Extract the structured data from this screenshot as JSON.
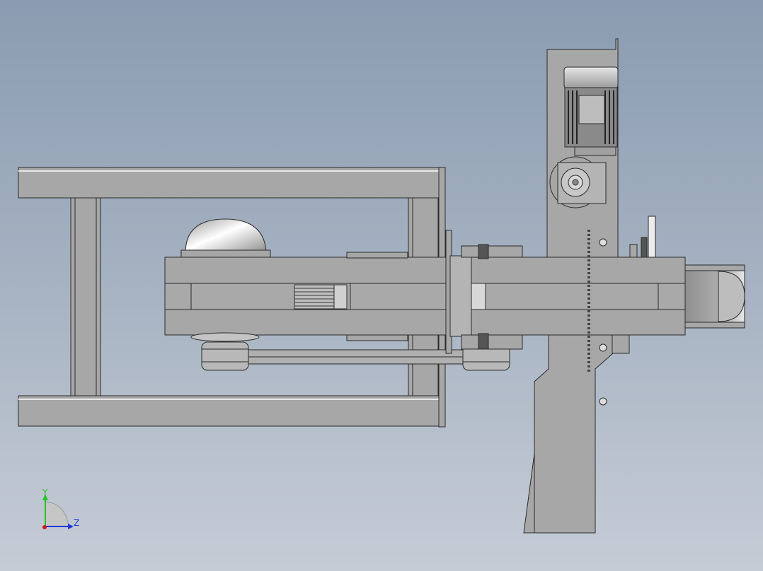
{
  "viewport": {
    "background_top": "#8a9cb1",
    "background_bottom": "#c6ccd6",
    "part_color": "#a7a7a7",
    "edge_color": "#2a2a2a"
  },
  "triad": {
    "y_label": "Y",
    "z_label": "Z",
    "y_color": "#27c227",
    "z_color": "#1f35d8",
    "x_color": "#d01a1a"
  }
}
